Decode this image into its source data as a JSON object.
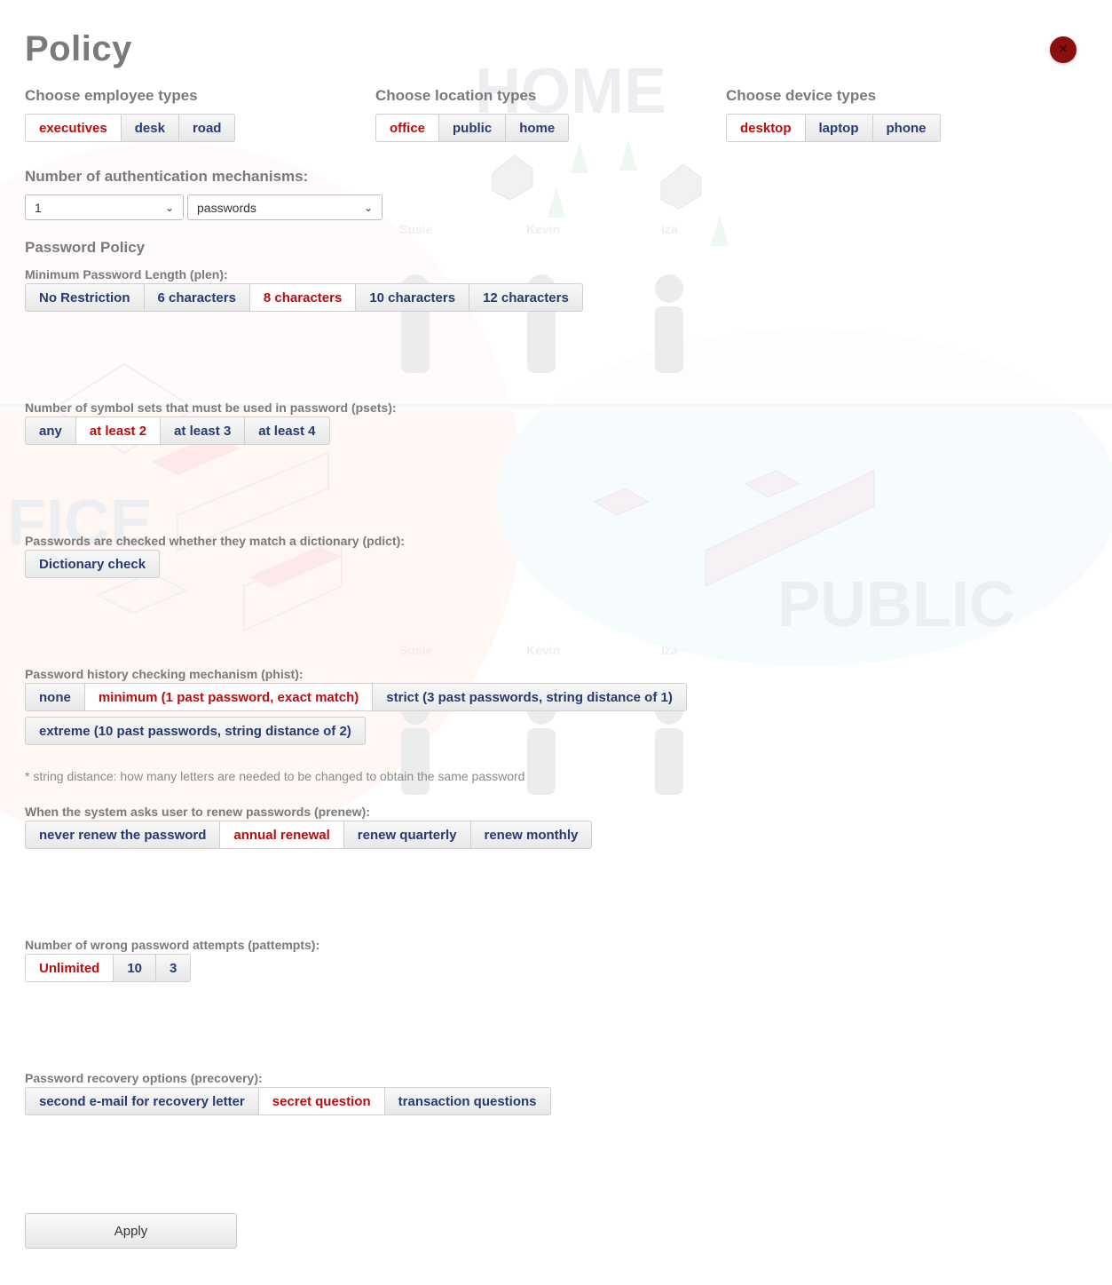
{
  "title": "Policy",
  "close_glyph": "×",
  "background": {
    "words": [
      "HOME",
      "FICE",
      "PUBLIC"
    ],
    "names": [
      "Susie",
      "Kevin",
      "Iza"
    ]
  },
  "employee_types": {
    "label": "Choose employee types",
    "options": [
      "executives",
      "desk",
      "road"
    ],
    "active": "executives"
  },
  "location_types": {
    "label": "Choose location types",
    "options": [
      "office",
      "public",
      "home"
    ],
    "active": "office"
  },
  "device_types": {
    "label": "Choose device types",
    "options": [
      "desktop",
      "laptop",
      "phone"
    ],
    "active": "desktop"
  },
  "auth": {
    "label": "Number of authentication mechanisms:",
    "count_value": "1",
    "mechanism_value": "passwords"
  },
  "password_policy": {
    "heading": "Password Policy",
    "plen": {
      "label": "Minimum Password Length (plen):",
      "options": [
        "No Restriction",
        "6 characters",
        "8 characters",
        "10 characters",
        "12 characters"
      ],
      "active": "8 characters"
    },
    "psets": {
      "label": "Number of symbol sets that must be used in password (psets):",
      "options": [
        "any",
        "at least 2",
        "at least 3",
        "at least 4"
      ],
      "active": "at least 2"
    },
    "pdict": {
      "label": "Passwords are checked whether they match a dictionary (pdict):",
      "options": [
        "Dictionary check"
      ],
      "active": ""
    },
    "phist": {
      "label": "Password history checking mechanism (phist):",
      "options": [
        "none",
        "minimum (1 past password, exact match)",
        "strict (3 past passwords, string distance of 1)",
        "extreme (10 past passwords, string distance of 2)"
      ],
      "active": "minimum (1 past password, exact match)",
      "note": "* string distance: how many letters are needed to be changed to obtain the same password"
    },
    "prenew": {
      "label": "When the system asks user to renew passwords (prenew):",
      "options": [
        "never renew the password",
        "annual renewal",
        "renew quarterly",
        "renew monthly"
      ],
      "active": "annual renewal"
    },
    "pattempts": {
      "label": "Number of wrong password attempts (pattempts):",
      "options": [
        "Unlimited",
        "10",
        "3"
      ],
      "active": "Unlimited"
    },
    "precovery": {
      "label": "Password recovery options (precovery):",
      "options": [
        "second e-mail for recovery letter",
        "secret question",
        "transaction questions"
      ],
      "active": "secret question"
    }
  },
  "apply_label": "Apply",
  "colors": {
    "active_text": "#c00b0b",
    "inactive_text": "#283a73",
    "close_button": "#8a0f0f"
  }
}
